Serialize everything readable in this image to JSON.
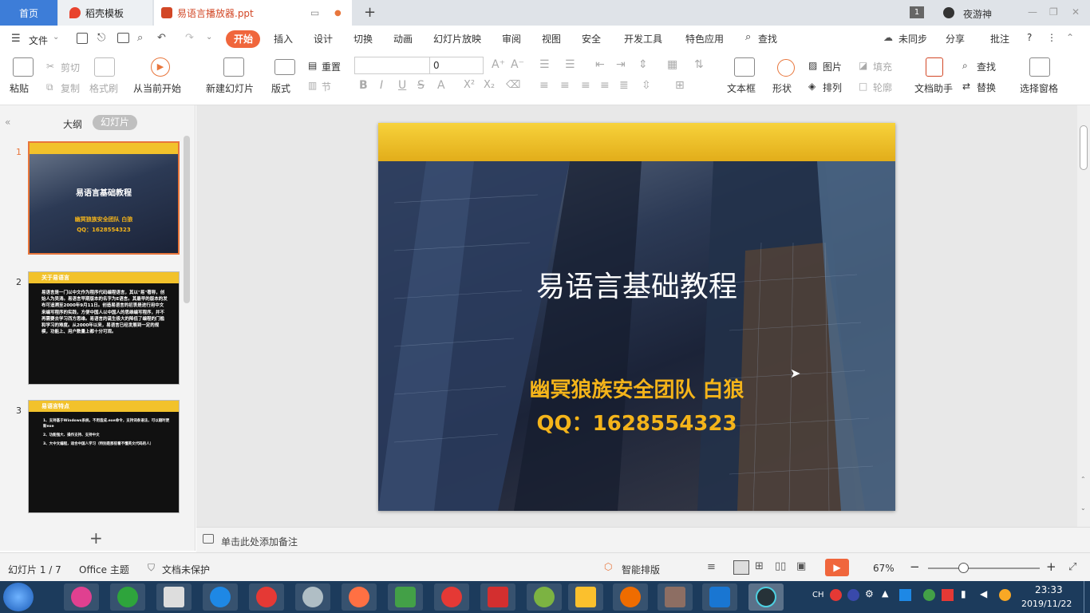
{
  "tabs": {
    "home": "首页",
    "daoke": "稻壳模板",
    "file": "易语言播放器.ppt",
    "add": "+"
  },
  "window": {
    "badge": "1",
    "user": "夜游神",
    "min": "—",
    "max": "❐",
    "close": "✕"
  },
  "menu": {
    "file": "文件",
    "items": [
      "开始",
      "插入",
      "设计",
      "切换",
      "动画",
      "幻灯片放映",
      "审阅",
      "视图",
      "安全",
      "开发工具",
      "特色应用"
    ],
    "search": "查找",
    "sync": "未同步",
    "share": "分享",
    "comment": "批注",
    "help": "?",
    "more": "⋮",
    "collapse": "⌃"
  },
  "ribbon": {
    "paste": "粘贴",
    "cut": "剪切",
    "copy": "复制",
    "format_painter": "格式刷",
    "play_from_start": "从当前开始",
    "new_slide": "新建幻灯片",
    "layout": "版式",
    "reset": "重置",
    "section": "节",
    "font_name": "",
    "font_size": "0",
    "textbox": "文本框",
    "shape": "形状",
    "image": "图片",
    "arrange": "排列",
    "fill": "填充",
    "outline": "轮廓",
    "doc_assistant": "文档助手",
    "find": "查找",
    "replace": "替换",
    "select_pane": "选择窗格"
  },
  "side": {
    "outline_tab": "大纲",
    "slides_tab": "幻灯片",
    "add": "+",
    "thumbs": [
      {
        "num": "1",
        "title": "易语言基础教程",
        "sub1": "幽冥狼族安全团队 白狼",
        "sub2": "QQ：1628554323"
      },
      {
        "num": "2",
        "title": "关于易语言",
        "body": "易语言是一门以中文作为程序代码编程语言，其以\"易\"著称，创始人为吴涛。易语言早期版本的名字为E语言。其最早的版本的发布可追溯至2000年9月11日。创造易语言的初衷是进行用中文来编写程序的实践，方便中国人以中国人的思维编写程序，并不再需要去学习西方思维。易语言的诞生极大的降低了编程的门槛和学习的难度。从2000年以来，易语言已经发展到一定的规模，功能上、用户数量上都十分可观。"
      },
      {
        "num": "3",
        "title": "易语言特点",
        "lines": [
          "1、支持基于Windows系统，不用造成.exe命令，支持词条语法，可以随时更新exe",
          "2、功能强大、操作支持、支持中文",
          "3、大中文编程，适合中国人学习（特别是那些看不懂英文代码的人）"
        ]
      }
    ]
  },
  "slide": {
    "title": "易语言基础教程",
    "subtitle": "幽冥狼族安全团队 白狼",
    "qq": "QQ：1628554323"
  },
  "notes": {
    "placeholder": "单击此处添加备注"
  },
  "status": {
    "slide_count": "幻灯片 1 / 7",
    "theme": "Office 主题",
    "protect": "文档未保护",
    "smart": "智能排版",
    "zoom": "67%",
    "zoom_minus": "−",
    "zoom_plus": "+"
  },
  "taskbar": {
    "ime": "CH",
    "time": "23:33",
    "date": "2019/11/22"
  },
  "colors": {
    "accent": "#d24726",
    "wps_blue": "#3d7dd8",
    "start_tab": "#f0663c",
    "slide_yellow": "#f2c22b",
    "subtitle_gold": "#f4b41a"
  }
}
